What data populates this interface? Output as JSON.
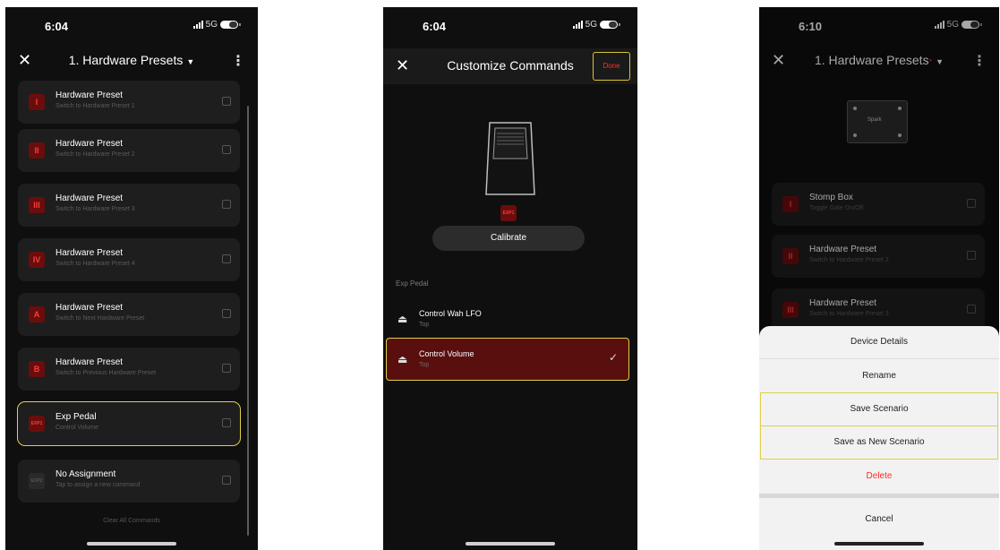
{
  "colors": {
    "accent_red": "#ff3030",
    "highlight_yellow": "#e0cf4a",
    "selected_row": "#5a0f0f"
  },
  "screen1": {
    "time": "6:04",
    "network": "5G",
    "title": "1. Hardware Presets",
    "items": [
      {
        "badge": "I",
        "title": "Hardware Preset",
        "subtitle": "Switch to Hardware Preset 1"
      },
      {
        "badge": "II",
        "title": "Hardware Preset",
        "subtitle": "Switch to Hardware Preset 2"
      },
      {
        "badge": "III",
        "title": "Hardware Preset",
        "subtitle": "Switch to Hardware Preset 3"
      },
      {
        "badge": "IV",
        "title": "Hardware Preset",
        "subtitle": "Switch to Hardware Preset 4"
      },
      {
        "badge": "A",
        "title": "Hardware Preset",
        "subtitle": "Switch to Next Hardware Preset"
      },
      {
        "badge": "B",
        "title": "Hardware Preset",
        "subtitle": "Switch to Previous Hardware Preset"
      },
      {
        "badge": "EXP1",
        "title": "Exp Pedal",
        "subtitle": "Control Volume"
      },
      {
        "badge": "EXP2",
        "title": "No Assignment",
        "subtitle": "Tap to assign a new command"
      }
    ],
    "clear_all": "Clear All Commands"
  },
  "screen2": {
    "time": "6:04",
    "network": "5G",
    "title": "Customize Commands",
    "done": "Done",
    "pedal_badge": "EXP1",
    "calibrate": "Calibrate",
    "section": "Exp Pedal",
    "options": [
      {
        "title": "Control Wah LFO",
        "subtitle": "Top"
      },
      {
        "title": "Control Volume",
        "subtitle": "Top"
      }
    ]
  },
  "screen3": {
    "time": "6:10",
    "network": "5G",
    "title": "1. Hardware Presets",
    "device_label": "Spark",
    "items": [
      {
        "badge": "I",
        "title": "Stomp Box",
        "subtitle": "Toggle Gate On/Off"
      },
      {
        "badge": "II",
        "title": "Hardware Preset",
        "subtitle": "Switch to Hardware Preset 2"
      },
      {
        "badge": "III",
        "title": "Hardware Preset",
        "subtitle": "Switch to Hardware Preset 3"
      }
    ],
    "menu": {
      "device_details": "Device Details",
      "rename": "Rename",
      "save_scenario": "Save Scenario",
      "save_new": "Save as New Scenario",
      "delete": "Delete",
      "cancel": "Cancel"
    }
  }
}
